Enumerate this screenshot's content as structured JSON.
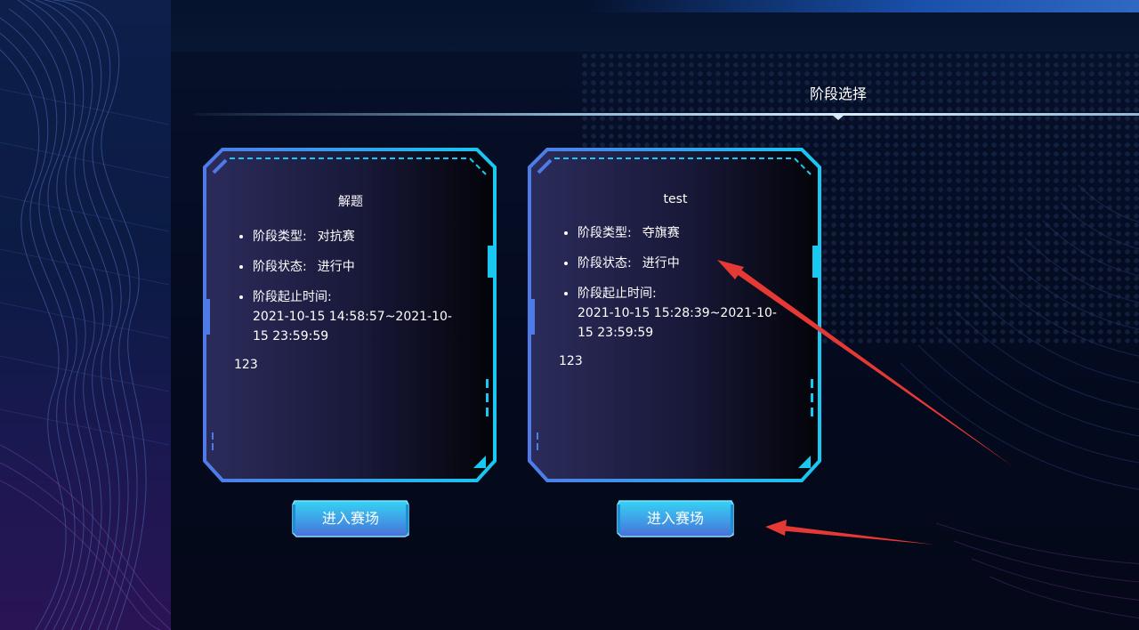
{
  "header": {
    "section_title": "阶段选择"
  },
  "stages": [
    {
      "name": "解题",
      "type_label": "阶段类型:",
      "type_value": "对抗赛",
      "status_label": "阶段状态:",
      "status_value": "进行中",
      "time_label": "阶段起止时间:",
      "time_value": "2021-10-15 14:58:57~2021-10-15 23:59:59",
      "note": "123",
      "button_label": "进入赛场"
    },
    {
      "name": "test",
      "type_label": "阶段类型:",
      "type_value": "夺旗赛",
      "status_label": "阶段状态:",
      "status_value": "进行中",
      "time_label": "阶段起止时间:",
      "time_value": "2021-10-15 15:28:39~2021-10-15 23:59:59",
      "note": "123",
      "button_label": "进入赛场"
    }
  ],
  "colors": {
    "frame_cyan": "#18c8f0",
    "frame_blue": "#3d6de8",
    "annotation_red": "#e53935",
    "button_top": "#36c6f2",
    "button_bottom": "#4a6fd6"
  }
}
